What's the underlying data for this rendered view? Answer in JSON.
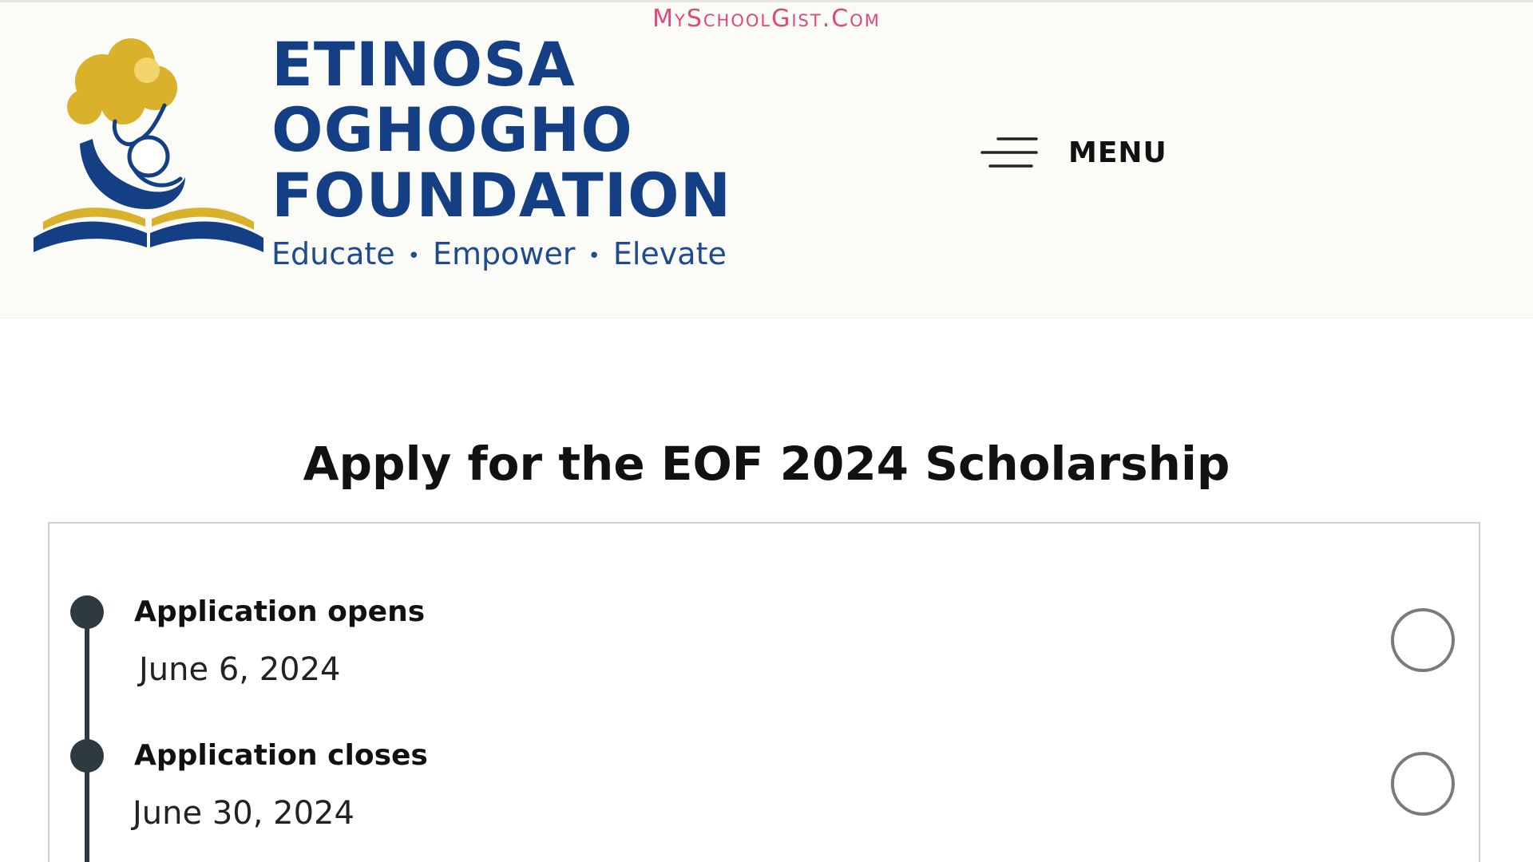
{
  "watermark": "MySchoolGist.Com",
  "brand": {
    "name_line1": "ETINOSA",
    "name_line2": "OGHOGHO",
    "name_line3": "FOUNDATION",
    "tagline_1": "Educate",
    "tagline_2": "Empower",
    "tagline_3": "Elevate",
    "separator": "•",
    "colors": {
      "navy": "#153f84",
      "gold": "#d9b12a"
    }
  },
  "header": {
    "menu_label": "MENU",
    "menu_icon": "hamburger-menu-icon"
  },
  "main": {
    "title": "Apply for the EOF 2024 Scholarship",
    "timeline": [
      {
        "label": "Application opens",
        "date": "June 6, 2024",
        "status_icon": "empty-circle-icon"
      },
      {
        "label": "Application closes",
        "date": "June 30, 2024",
        "status_icon": "empty-circle-icon"
      }
    ]
  }
}
